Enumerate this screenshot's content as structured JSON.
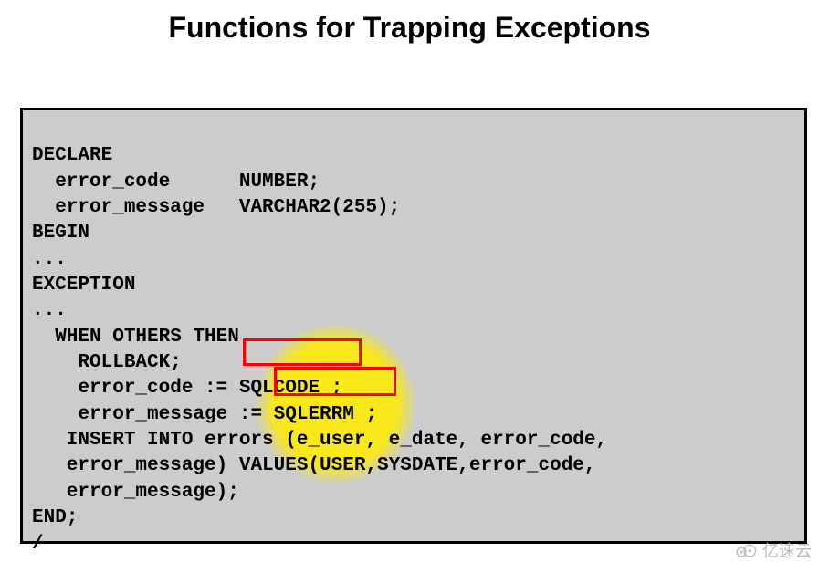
{
  "title": "Functions for Trapping Exceptions",
  "code": {
    "l01": "DECLARE",
    "l02": "  error_code      NUMBER;",
    "l03": "  error_message   VARCHAR2(255);",
    "l04": "BEGIN",
    "l05": "...",
    "l06": "EXCEPTION",
    "l07": "...",
    "l08": "  WHEN OTHERS THEN",
    "l09": "    ROLLBACK;",
    "l10": "    error_code := SQLCODE ;",
    "l11": "    error_message := SQLERRM ;",
    "l12": "   INSERT INTO errors (e_user, e_date, error_code,",
    "l13": "   error_message) VALUES(USER,SYSDATE,error_code,",
    "l14": "   error_message);",
    "l15": "END;",
    "l16": "/"
  },
  "highlight": {
    "box1_label": "SQLCODE",
    "box2_label": "SQLERRM"
  },
  "watermark": {
    "text": "亿速云"
  }
}
